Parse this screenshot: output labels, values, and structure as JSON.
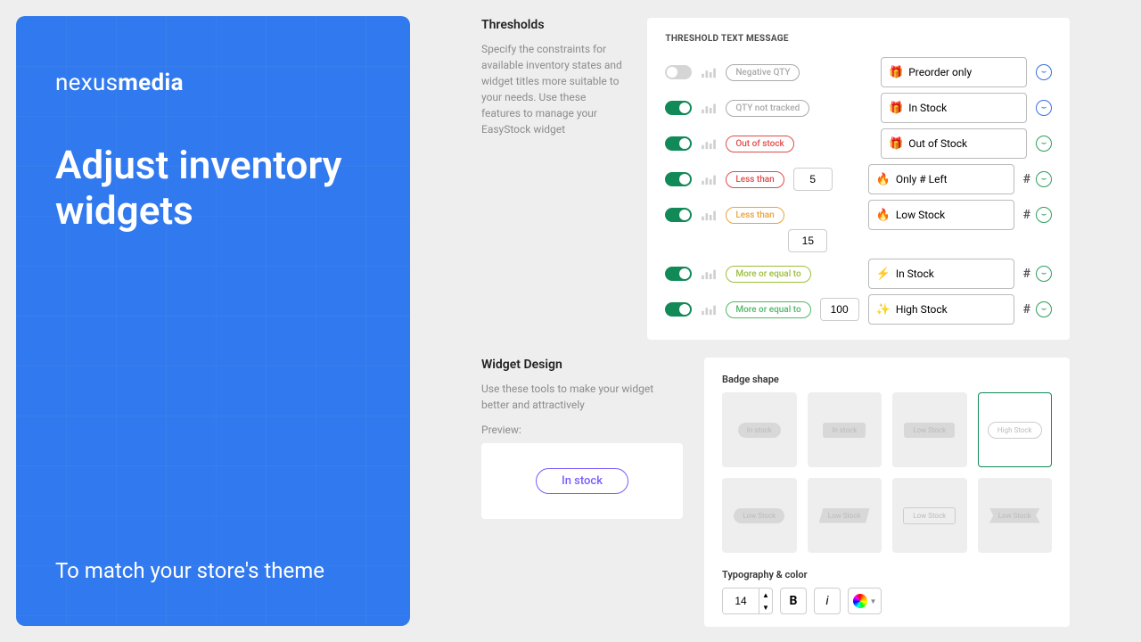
{
  "hero": {
    "logo_prefix": "nexus",
    "logo_bold": "media",
    "title": "Adjust inventory widgets",
    "tagline": "To match your store's theme"
  },
  "thresholds": {
    "title": "Thresholds",
    "desc": "Specify the constraints for available inventory states and widget titles more suitable to your needs. Use these features to manage your EasyStock widget",
    "panel_label": "THRESHOLD TEXT MESSAGE",
    "rows": [
      {
        "on": false,
        "cond": "Negative QTY",
        "cond_color": "#aaa",
        "num": "",
        "emoji": "🎁",
        "msg": "Preorder only",
        "hash": false,
        "face": "#3b6ee0"
      },
      {
        "on": true,
        "cond": "QTY not tracked",
        "cond_color": "#aaa",
        "num": "",
        "emoji": "🎁",
        "msg": "In Stock",
        "hash": false,
        "face": "#3b6ee0"
      },
      {
        "on": true,
        "cond": "Out of stock",
        "cond_color": "#e24a4a",
        "num": "",
        "emoji": "🎁",
        "msg": "Out of Stock",
        "hash": false,
        "face": "#2e9e5b"
      },
      {
        "on": true,
        "cond": "Less than",
        "cond_color": "#e24a4a",
        "num": "5",
        "emoji": "🔥",
        "msg": "Only # Left",
        "hash": true,
        "face": "#2e9e5b"
      },
      {
        "on": true,
        "cond": "Less than",
        "cond_color": "#e8a33b",
        "num": "15",
        "emoji": "🔥",
        "msg": "Low Stock",
        "hash": true,
        "face": "#2e9e5b"
      },
      {
        "on": true,
        "cond": "More or equal to",
        "cond_color": "#9cbf3b",
        "num": "",
        "emoji": "⚡",
        "msg": "In Stock",
        "hash": true,
        "face": "#2e9e5b"
      },
      {
        "on": true,
        "cond": "More or equal to",
        "cond_color": "#4fb767",
        "num": "100",
        "emoji": "✨",
        "msg": "High Stock",
        "hash": true,
        "face": "#2e9e5b"
      }
    ]
  },
  "design": {
    "title": "Widget Design",
    "desc": "Use these tools to make your widget better and attractively",
    "preview_label": "Preview:",
    "preview_badge": "In stock",
    "badge_shape_label": "Badge shape",
    "shapes": [
      "In stock",
      "In stock",
      "Low Stock",
      "High Stock",
      "Low Stock",
      "Low Stock",
      "Low Stock",
      "Low Stock"
    ],
    "shapes_selected_index": 3,
    "typo_label": "Typography & color",
    "font_size": "14",
    "bold_label": "B",
    "italic_label": "i"
  }
}
